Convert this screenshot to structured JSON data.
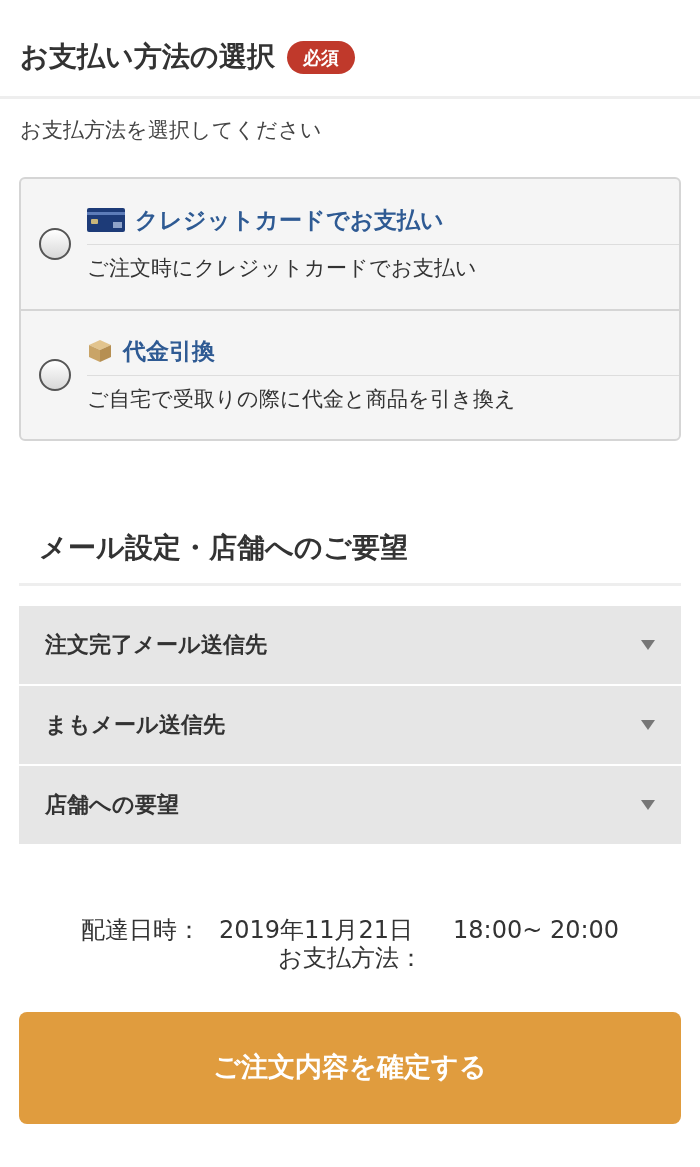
{
  "payment": {
    "title": "お支払い方法の選択",
    "badge": "必須",
    "instruction": "お支払方法を選択してください",
    "options": [
      {
        "kind": "card",
        "label": "クレジットカードでお支払い",
        "description": "ご注文時にクレジットカードでお支払い",
        "selected": false
      },
      {
        "kind": "box",
        "label": "代金引換",
        "description": "ご自宅で受取りの際に代金と商品を引き換え",
        "selected": false
      }
    ]
  },
  "mail": {
    "title": "メール設定・店舗へのご要望",
    "sections": [
      {
        "label": "注文完了メール送信先",
        "expanded": false
      },
      {
        "label": "まもメール送信先",
        "expanded": false
      },
      {
        "label": "店舗への要望",
        "expanded": false
      }
    ]
  },
  "summary": {
    "delivery_label": "配達日時：",
    "delivery_date": "2019年11月21日",
    "delivery_time": "18:00~ 20:00",
    "payment_label": "お支払方法："
  },
  "confirm_button": "ご注文内容を確定する"
}
